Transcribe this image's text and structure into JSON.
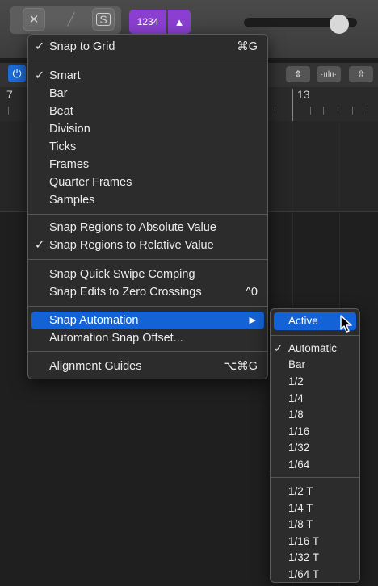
{
  "toolbar": {
    "close_icon": "✕",
    "solo_label": "S",
    "counter_label": "1234"
  },
  "ruler": {
    "bar_left": "7",
    "bar_right": "13"
  },
  "menu": {
    "items": [
      {
        "check": "✓",
        "label": "Snap to Grid",
        "shortcut": "⌘G"
      },
      {
        "check": "✓",
        "label": "Smart",
        "shortcut": ""
      },
      {
        "check": "",
        "label": "Bar",
        "shortcut": ""
      },
      {
        "check": "",
        "label": "Beat",
        "shortcut": ""
      },
      {
        "check": "",
        "label": "Division",
        "shortcut": ""
      },
      {
        "check": "",
        "label": "Ticks",
        "shortcut": ""
      },
      {
        "check": "",
        "label": "Frames",
        "shortcut": ""
      },
      {
        "check": "",
        "label": "Quarter Frames",
        "shortcut": ""
      },
      {
        "check": "",
        "label": "Samples",
        "shortcut": ""
      },
      {
        "check": "",
        "label": "Snap Regions to Absolute Value",
        "shortcut": ""
      },
      {
        "check": "✓",
        "label": "Snap Regions to Relative Value",
        "shortcut": ""
      },
      {
        "check": "",
        "label": "Snap Quick Swipe Comping",
        "shortcut": ""
      },
      {
        "check": "",
        "label": "Snap Edits to Zero Crossings",
        "shortcut": "^0"
      },
      {
        "check": "",
        "label": "Snap Automation",
        "shortcut": "▶"
      },
      {
        "check": "",
        "label": "Automation Snap Offset...",
        "shortcut": ""
      },
      {
        "check": "",
        "label": "Alignment Guides",
        "shortcut": "⌥⌘G"
      }
    ]
  },
  "submenu": {
    "items": [
      {
        "check": "",
        "label": "Active"
      },
      {
        "check": "✓",
        "label": "Automatic"
      },
      {
        "check": "",
        "label": "Bar"
      },
      {
        "check": "",
        "label": "1/2"
      },
      {
        "check": "",
        "label": "1/4"
      },
      {
        "check": "",
        "label": "1/8"
      },
      {
        "check": "",
        "label": "1/16"
      },
      {
        "check": "",
        "label": "1/32"
      },
      {
        "check": "",
        "label": "1/64"
      },
      {
        "check": "",
        "label": "1/2 T"
      },
      {
        "check": "",
        "label": "1/4 T"
      },
      {
        "check": "",
        "label": "1/8 T"
      },
      {
        "check": "",
        "label": "1/16 T"
      },
      {
        "check": "",
        "label": "1/32 T"
      },
      {
        "check": "",
        "label": "1/64 T"
      }
    ]
  },
  "colors": {
    "highlight": "#1463d6",
    "menu_bg": "#2c2c2c",
    "purple_accent": "#8a3fd0"
  }
}
